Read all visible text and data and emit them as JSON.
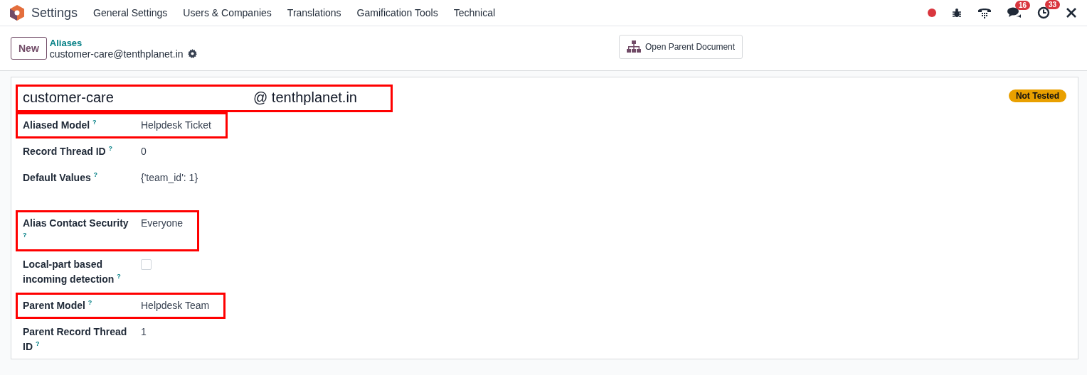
{
  "navbar": {
    "app": "Settings",
    "menu": [
      "General Settings",
      "Users & Companies",
      "Translations",
      "Gamification Tools",
      "Technical"
    ],
    "systray": [
      {
        "kind": "record"
      },
      {
        "kind": "bug"
      },
      {
        "kind": "phone"
      },
      {
        "kind": "chat",
        "badge": "16"
      },
      {
        "kind": "activity",
        "badge": "33"
      },
      {
        "kind": "tools"
      }
    ]
  },
  "control_panel": {
    "new_button": "New",
    "breadcrumb": "Aliases",
    "record": "customer-care@tenthplanet.in",
    "action": "Open Parent Document"
  },
  "form": {
    "alias_name": "customer-care",
    "domain": "@ tenthplanet.in",
    "name_highlighted": true,
    "status": "Not Tested",
    "field_groups": [
      {
        "fields": [
          {
            "label": "Aliased Model $^{?}$",
            "kind": "text",
            "value": "Helpdesk Ticket",
            "highlighted": true
          },
          {
            "label": "Record Thread ID $^{?}$",
            "kind": "text",
            "value": "0",
            "highlighted": false
          },
          {
            "label": "Default Values $^{?}$",
            "kind": "text",
            "value": "{'team_id': 1}",
            "highlighted": false
          }
        ]
      },
      {
        "fields": [
          {
            "label": "Alias Contact Security $^{?}$",
            "kind": "text",
            "value": "Everyone",
            "highlighted": true
          },
          {
            "label": "Local-part based incoming detection $^{?}$",
            "kind": "checkbox",
            "checked": false,
            "highlighted": false
          },
          {
            "label": "Parent Model $^{?}$",
            "kind": "text",
            "value": "Helpdesk Team",
            "highlighted": true
          },
          {
            "label": "Parent Record Thread ID $^{?}$",
            "kind": "text",
            "value": "1",
            "highlighted": false
          }
        ]
      }
    ]
  }
}
